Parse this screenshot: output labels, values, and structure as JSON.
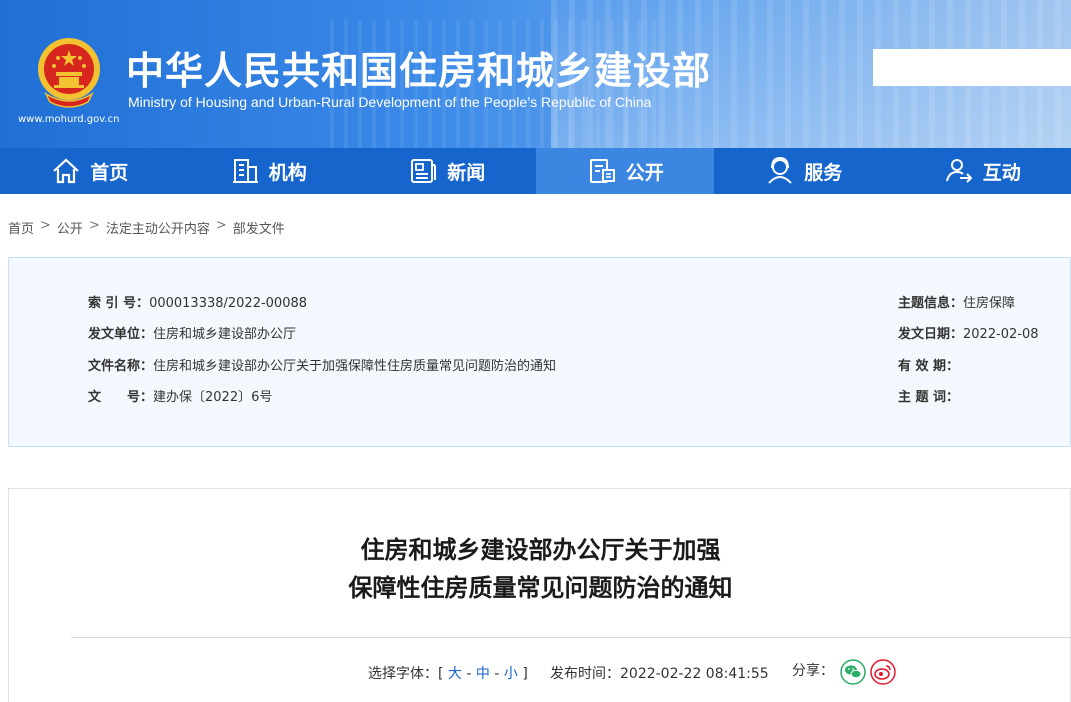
{
  "header": {
    "title": "中华人民共和国住房和城乡建设部",
    "subtitle": "Ministry of Housing and Urban-Rural Development of the People’s Republic of China",
    "url": "www.mohurd.gov.cn"
  },
  "nav": {
    "items": [
      {
        "label": "首页",
        "icon": "home-icon"
      },
      {
        "label": "机构",
        "icon": "building-icon"
      },
      {
        "label": "新闻",
        "icon": "news-icon"
      },
      {
        "label": "公开",
        "icon": "disclosure-icon",
        "active": true
      },
      {
        "label": "服务",
        "icon": "service-icon"
      },
      {
        "label": "互动",
        "icon": "interaction-icon"
      }
    ]
  },
  "breadcrumb": {
    "items": [
      "首页",
      "公开",
      "法定主动公开内容",
      "部发文件"
    ],
    "separator": ">"
  },
  "info": {
    "index_label": "索 引 号：",
    "index_value": "000013338/2022-00088",
    "issuer_label": "发文单位：",
    "issuer_value": "住房和城乡建设部办公厅",
    "docname_label": "文件名称：",
    "docname_value": "住房和城乡建设部办公厅关于加强保障性住房质量常见问题防治的通知",
    "docno_label": "文　　号：",
    "docno_value": "建办保〔2022〕6号",
    "topic_label": "主题信息：",
    "topic_value": "住房保障",
    "date_label": "发文日期：",
    "date_value": "2022-02-08",
    "validity_label": "有 效 期：",
    "validity_value": "",
    "keywords_label": "主 题 词：",
    "keywords_value": ""
  },
  "article": {
    "title_line1": "住房和城乡建设部办公厅关于加强",
    "title_line2": "保障性住房质量常见问题防治的通知",
    "font_select_label": "选择字体：[",
    "font_large": "大",
    "font_medium": "中",
    "font_small": "小",
    "font_dash": "-",
    "font_close": "]",
    "publish_time": "发布时间：2022-02-22 08:41:55",
    "share_label": "分享："
  },
  "colors": {
    "nav_bg": "#1665cc",
    "nav_active": "#3a86e0",
    "link": "#1665cc",
    "wechat": "#2aae67",
    "weibo": "#e6162d"
  }
}
